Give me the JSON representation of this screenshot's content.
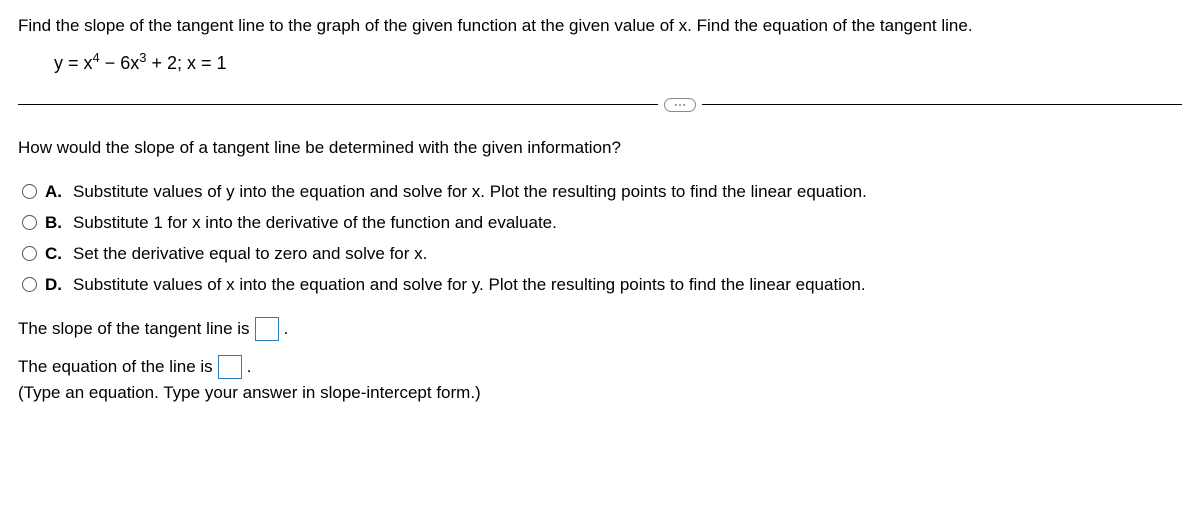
{
  "question": "Find the slope of the tangent line to the graph of the given function at the given value of x. Find the equation of the tangent line.",
  "equation_html": "y = x<sup>4</sup> − 6x<sup>3</sup> + 2;  x = 1",
  "sub_question": "How would the slope of a tangent line be determined with the given information?",
  "options": {
    "A": {
      "letter": "A.",
      "text": "Substitute values of y into the equation and solve for x. Plot the resulting points to find the linear equation."
    },
    "B": {
      "letter": "B.",
      "text": "Substitute 1 for x into the derivative of the function and evaluate."
    },
    "C": {
      "letter": "C.",
      "text": "Set the derivative equal to zero and solve for x."
    },
    "D": {
      "letter": "D.",
      "text": "Substitute values of x into the equation and solve for y. Plot the resulting points to find the linear equation."
    }
  },
  "slope_prefix": "The slope of the tangent line is ",
  "slope_suffix": ".",
  "eqline_prefix": "The equation of the line is ",
  "eqline_suffix": ".",
  "hint": "(Type an equation. Type your answer in slope-intercept form.)"
}
